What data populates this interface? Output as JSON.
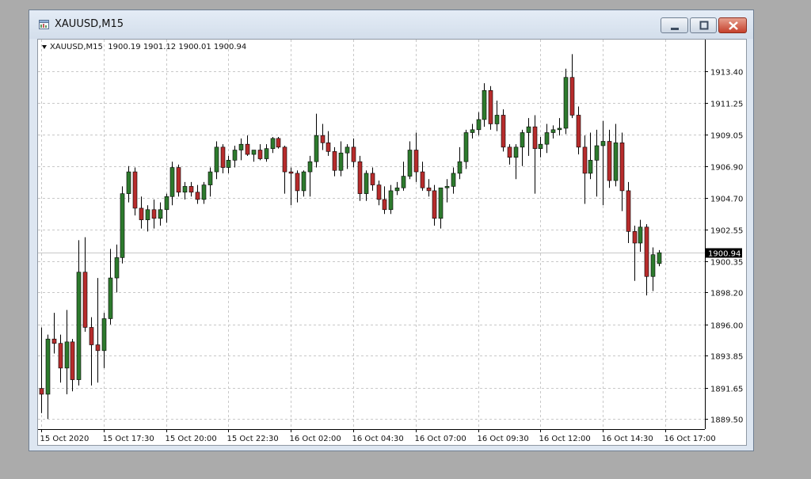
{
  "window": {
    "title": "XAUUSD,M15",
    "title_icon": "chart-window-icon",
    "buttons": [
      "minimize-icon",
      "maximize-icon",
      "close-icon"
    ]
  },
  "info_bar": {
    "symbol": "XAUUSD,M15",
    "values": "1900.19 1901.12 1900.01 1900.94"
  },
  "colors": {
    "bull": "#2d7a2d",
    "bear": "#b72c2c",
    "grid": "#c8c8c8",
    "price_line": "#c8c8c8",
    "price_label_bg": "#000000",
    "price_label_text": "#ffffff"
  },
  "chart_data": {
    "type": "candlestick",
    "symbol": "XAUUSD",
    "timeframe": "M15",
    "ylim": [
      1888.8,
      1915.6
    ],
    "y_ticks": [
      "1913.40",
      "1911.25",
      "1909.05",
      "1906.90",
      "1904.70",
      "1902.55",
      "1900.35",
      "1898.20",
      "1896.00",
      "1893.85",
      "1891.65",
      "1889.50"
    ],
    "x_ticks": [
      "15 Oct 2020",
      "15 Oct 17:30",
      "15 Oct 20:00",
      "15 Oct 22:30",
      "16 Oct 02:00",
      "16 Oct 04:30",
      "16 Oct 07:00",
      "16 Oct 09:30",
      "16 Oct 12:00",
      "16 Oct 14:30",
      "16 Oct 17:00"
    ],
    "x_tick_bar_index": [
      0,
      10,
      20,
      30,
      40,
      50,
      60,
      70,
      80,
      90,
      100
    ],
    "grid": true,
    "current_price": 1900.94,
    "candles": [
      [
        1891.6,
        1895.8,
        1889.9,
        1891.2
      ],
      [
        1891.2,
        1895.3,
        1889.5,
        1895.0
      ],
      [
        1895.0,
        1896.8,
        1894.0,
        1894.7
      ],
      [
        1894.7,
        1895.3,
        1892.0,
        1893.0
      ],
      [
        1893.0,
        1897.0,
        1891.2,
        1894.8
      ],
      [
        1894.8,
        1895.0,
        1891.4,
        1892.2
      ],
      [
        1892.2,
        1901.8,
        1891.8,
        1899.6
      ],
      [
        1899.6,
        1902.0,
        1895.5,
        1895.8
      ],
      [
        1895.8,
        1896.5,
        1891.8,
        1894.6
      ],
      [
        1894.6,
        1899.2,
        1892.0,
        1894.2
      ],
      [
        1894.2,
        1896.8,
        1893.0,
        1896.4
      ],
      [
        1896.4,
        1901.2,
        1896.0,
        1899.2
      ],
      [
        1899.2,
        1901.5,
        1898.2,
        1900.6
      ],
      [
        1900.6,
        1905.5,
        1900.2,
        1905.0
      ],
      [
        1905.0,
        1906.9,
        1904.4,
        1906.5
      ],
      [
        1906.5,
        1906.8,
        1903.5,
        1904.0
      ],
      [
        1904.0,
        1904.8,
        1902.6,
        1903.2
      ],
      [
        1903.2,
        1904.2,
        1902.4,
        1903.9
      ],
      [
        1903.9,
        1904.6,
        1902.6,
        1903.3
      ],
      [
        1903.3,
        1904.4,
        1902.8,
        1903.9
      ],
      [
        1903.9,
        1905.0,
        1903.0,
        1904.8
      ],
      [
        1904.8,
        1907.2,
        1904.2,
        1906.8
      ],
      [
        1906.8,
        1907.0,
        1904.8,
        1905.1
      ],
      [
        1905.1,
        1905.8,
        1904.6,
        1905.5
      ],
      [
        1905.5,
        1905.8,
        1904.8,
        1905.1
      ],
      [
        1905.1,
        1905.6,
        1904.3,
        1904.6
      ],
      [
        1904.6,
        1905.8,
        1904.3,
        1905.6
      ],
      [
        1905.6,
        1906.8,
        1904.8,
        1906.5
      ],
      [
        1906.5,
        1908.6,
        1906.0,
        1908.2
      ],
      [
        1908.2,
        1908.4,
        1906.4,
        1906.8
      ],
      [
        1906.8,
        1907.6,
        1906.4,
        1907.3
      ],
      [
        1907.3,
        1908.3,
        1906.8,
        1908.0
      ],
      [
        1908.0,
        1908.8,
        1907.3,
        1908.4
      ],
      [
        1908.4,
        1909.0,
        1907.6,
        1907.7
      ],
      [
        1907.7,
        1908.0,
        1907.2,
        1908.0
      ],
      [
        1908.0,
        1908.4,
        1907.3,
        1907.4
      ],
      [
        1907.4,
        1908.4,
        1907.2,
        1908.1
      ],
      [
        1908.1,
        1908.9,
        1907.8,
        1908.8
      ],
      [
        1908.8,
        1908.9,
        1908.1,
        1908.2
      ],
      [
        1908.2,
        1908.3,
        1905.0,
        1906.5
      ],
      [
        1906.5,
        1906.8,
        1904.2,
        1906.4
      ],
      [
        1906.4,
        1906.6,
        1904.4,
        1905.2
      ],
      [
        1905.2,
        1906.6,
        1904.8,
        1906.5
      ],
      [
        1906.5,
        1907.6,
        1904.8,
        1907.2
      ],
      [
        1907.2,
        1910.5,
        1906.8,
        1909.0
      ],
      [
        1909.0,
        1909.8,
        1908.0,
        1908.5
      ],
      [
        1908.5,
        1909.3,
        1907.6,
        1907.9
      ],
      [
        1907.9,
        1908.2,
        1906.2,
        1906.6
      ],
      [
        1906.6,
        1908.6,
        1906.2,
        1907.8
      ],
      [
        1907.8,
        1908.4,
        1906.7,
        1908.2
      ],
      [
        1908.2,
        1908.8,
        1906.8,
        1907.2
      ],
      [
        1907.2,
        1907.6,
        1904.5,
        1905.0
      ],
      [
        1905.0,
        1906.6,
        1904.5,
        1906.4
      ],
      [
        1906.4,
        1906.8,
        1905.2,
        1905.6
      ],
      [
        1905.6,
        1905.9,
        1904.2,
        1904.6
      ],
      [
        1904.6,
        1905.5,
        1903.6,
        1903.9
      ],
      [
        1903.9,
        1905.6,
        1903.6,
        1905.2
      ],
      [
        1905.2,
        1905.8,
        1904.9,
        1905.4
      ],
      [
        1905.4,
        1907.2,
        1905.2,
        1906.2
      ],
      [
        1906.2,
        1908.6,
        1906.0,
        1908.0
      ],
      [
        1908.0,
        1909.2,
        1905.8,
        1906.5
      ],
      [
        1906.5,
        1907.2,
        1905.2,
        1905.4
      ],
      [
        1905.4,
        1906.0,
        1904.8,
        1905.2
      ],
      [
        1905.2,
        1905.6,
        1902.8,
        1903.3
      ],
      [
        1903.3,
        1905.4,
        1902.6,
        1905.4
      ],
      [
        1905.4,
        1906.0,
        1904.4,
        1905.5
      ],
      [
        1905.5,
        1906.8,
        1905.0,
        1906.4
      ],
      [
        1906.4,
        1908.2,
        1906.0,
        1907.2
      ],
      [
        1907.2,
        1909.4,
        1906.7,
        1909.2
      ],
      [
        1909.2,
        1909.8,
        1908.8,
        1909.4
      ],
      [
        1909.4,
        1910.6,
        1909.0,
        1910.1
      ],
      [
        1910.1,
        1912.6,
        1909.6,
        1912.1
      ],
      [
        1912.1,
        1912.4,
        1909.4,
        1909.8
      ],
      [
        1909.8,
        1911.4,
        1909.3,
        1910.4
      ],
      [
        1910.4,
        1910.8,
        1907.9,
        1908.2
      ],
      [
        1908.2,
        1908.4,
        1907.0,
        1907.5
      ],
      [
        1907.5,
        1908.4,
        1906.0,
        1908.2
      ],
      [
        1908.2,
        1909.4,
        1906.9,
        1909.2
      ],
      [
        1909.2,
        1910.2,
        1907.6,
        1909.6
      ],
      [
        1909.6,
        1910.4,
        1905.0,
        1908.1
      ],
      [
        1908.1,
        1908.9,
        1907.5,
        1908.4
      ],
      [
        1908.4,
        1909.8,
        1907.8,
        1909.2
      ],
      [
        1909.2,
        1909.7,
        1908.8,
        1909.4
      ],
      [
        1909.4,
        1910.2,
        1909.0,
        1909.5
      ],
      [
        1909.5,
        1913.6,
        1909.1,
        1913.0
      ],
      [
        1913.0,
        1914.6,
        1910.2,
        1910.4
      ],
      [
        1910.4,
        1911.0,
        1907.7,
        1908.2
      ],
      [
        1908.2,
        1909.0,
        1904.3,
        1906.4
      ],
      [
        1906.4,
        1909.2,
        1906.0,
        1907.3
      ],
      [
        1907.3,
        1909.4,
        1904.8,
        1908.3
      ],
      [
        1908.3,
        1910.0,
        1904.2,
        1908.6
      ],
      [
        1908.6,
        1909.4,
        1905.4,
        1905.9
      ],
      [
        1905.9,
        1909.8,
        1905.5,
        1908.5
      ],
      [
        1908.5,
        1909.2,
        1903.8,
        1905.2
      ],
      [
        1905.2,
        1905.8,
        1901.6,
        1902.4
      ],
      [
        1902.4,
        1902.8,
        1899.0,
        1901.6
      ],
      [
        1901.6,
        1903.2,
        1901.0,
        1902.7
      ],
      [
        1902.7,
        1902.9,
        1898.0,
        1899.3
      ],
      [
        1899.3,
        1901.3,
        1898.3,
        1900.8
      ],
      [
        1900.19,
        1901.12,
        1900.01,
        1900.94
      ]
    ]
  }
}
